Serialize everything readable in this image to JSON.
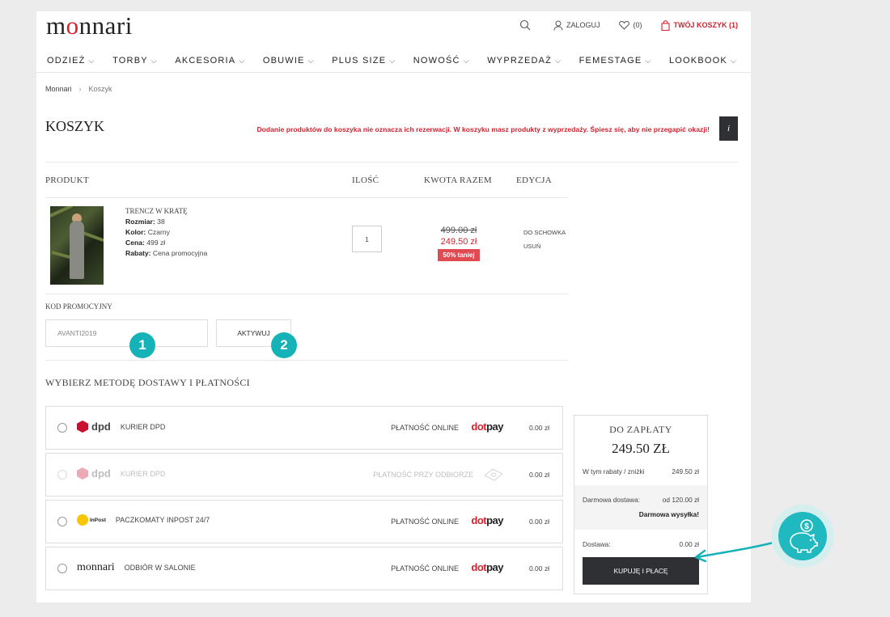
{
  "header": {
    "logo": "monnari",
    "login_label": "ZALOGUJ",
    "wishlist_count": "(0)",
    "cart_label": "TWÓJ KOSZYK (1)"
  },
  "nav": [
    "ODZIEŻ",
    "TORBY",
    "AKCESORIA",
    "OBUWIE",
    "PLUS SIZE",
    "NOWOŚĆ",
    "WYPRZEDAŻ",
    "FEMESTAGE",
    "LOOKBOOK"
  ],
  "breadcrumb": {
    "home": "Monnari",
    "current": "Koszyk"
  },
  "page_title": "KOSZYK",
  "notice": "Dodanie produktów do koszyka nie oznacza ich rezerwacji. W koszyku masz produkty z wyprzedaży. Śpiesz się, aby nie przegapić okazji!",
  "info_icon": "i",
  "table": {
    "headers": {
      "product": "PRODUKT",
      "qty": "ILOŚĆ",
      "total": "KWOTA RAZEM",
      "edit": "EDYCJA"
    }
  },
  "item": {
    "name": "TRENCZ W KRATĘ",
    "size_label": "Rozmiar:",
    "size": "38",
    "color_label": "Kolor:",
    "color": "Czarny",
    "price_label": "Cena:",
    "price": "499 zł",
    "discount_label": "Rabaty:",
    "discount": "Cena promocyjna",
    "quantity": "1",
    "old_price": "499.00 zł",
    "new_price": "249.50 zł",
    "discount_badge": "50% taniej",
    "edit_stash": "DO SCHOWKA",
    "edit_remove": "USUŃ"
  },
  "promo": {
    "label": "KOD PROMOCYJNY",
    "value": "AVANTI2019",
    "button": "AKTYWUJ",
    "step1": "1",
    "step2": "2"
  },
  "shipping": {
    "title": "WYBIERZ METODĘ DOSTAWY I PŁATNOŚCI",
    "options": [
      {
        "logo": "dpd",
        "carrier": "KURIER DPD",
        "payment": "PŁATNOŚĆ ONLINE",
        "pay_logo_a": "dot",
        "pay_logo_b": "pay",
        "price": "0.00 zł"
      },
      {
        "logo": "dpd",
        "carrier": "KURIER DPD",
        "payment": "PŁATNOŚĆ PRZY ODBIORZE",
        "price": "0.00 zł"
      },
      {
        "logo": "InPost",
        "carrier": "PACZKOMATY INPOST 24/7",
        "payment": "PŁATNOŚĆ ONLINE",
        "pay_logo_a": "dot",
        "pay_logo_b": "pay",
        "price": "0.00 zł"
      },
      {
        "logo": "monnari",
        "carrier": "ODBIÓR W SALONIE",
        "payment": "PŁATNOŚĆ ONLINE",
        "pay_logo_a": "dot",
        "pay_logo_b": "pay",
        "price": "0.00 zł"
      }
    ]
  },
  "summary": {
    "label": "DO ZAPŁATY",
    "total": "249.50 ZŁ",
    "discounts_label": "W tym rabaty / zniżki",
    "discounts_value": "249.50 zł",
    "free_label": "Darmowa dostawa:",
    "free_value": "od 120.00 zł",
    "free_note": "Darmowa wysyłka!",
    "delivery_label": "Dostawa:",
    "delivery_value": "0.00 zł",
    "buy_button": "KUPUJĘ I PŁACĘ"
  },
  "colors": {
    "accent": "#d3232f",
    "teal": "#15b3b8",
    "dark": "#2f3033"
  }
}
